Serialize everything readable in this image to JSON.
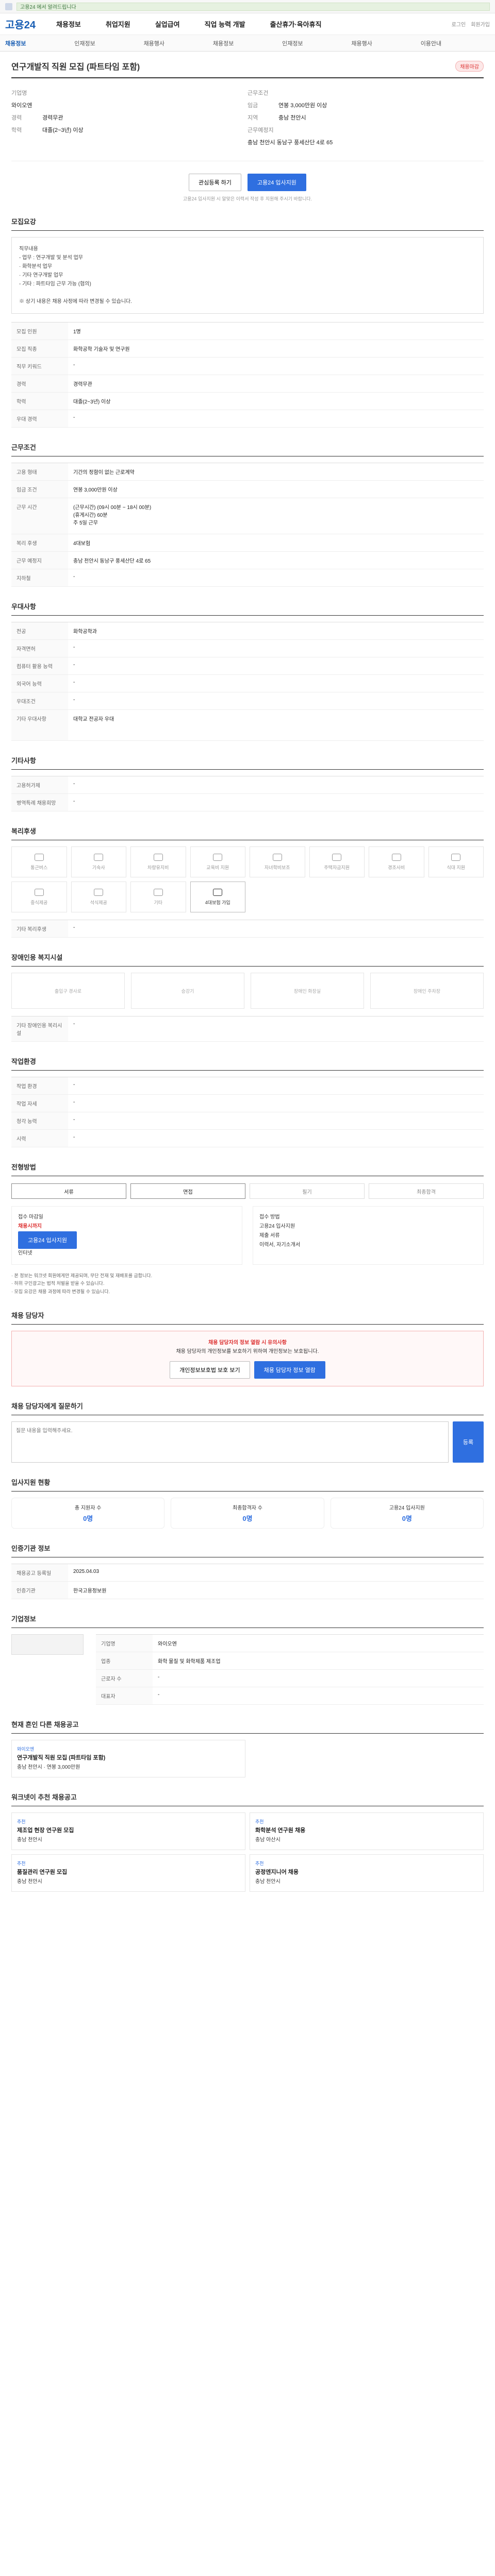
{
  "topbar": {
    "notice": "고용24 에서 알려드립니다"
  },
  "header": {
    "logo": "고용24",
    "nav": [
      "채용정보",
      "취업지원",
      "실업급여",
      "직업 능력 개발",
      "출산휴가·육아휴직"
    ],
    "util": [
      "로그인",
      "회원가입"
    ]
  },
  "tabs": [
    "채용정보",
    "인재정보",
    "채용행사",
    "채용정보",
    "인재정보",
    "채용행사",
    "이용안내"
  ],
  "job": {
    "title": "연구개발직 직원 모집 (파트타임 포함)",
    "badge": "채용마감",
    "company_label": "기업명",
    "company": "와이오엔",
    "left_kv": [
      {
        "k": "경력",
        "v": "경력무관"
      },
      {
        "k": "학력",
        "v": "대졸(2~3년) 이상"
      }
    ],
    "cond_label": "근무조건",
    "cond_kv": [
      {
        "k": "임금",
        "v": "연봉 3,000만원 이상"
      },
      {
        "k": "지역",
        "v": "충남 천안시"
      }
    ],
    "place_label": "근무예정지",
    "place": "충남 천안시 동남구 풍세산단 4로 65",
    "apply_buttons": [
      "관심등록 하기",
      "고용24 입사지원"
    ],
    "apply_note": "고용24 입사지원 시 알맞은 이력서 작성 후 지원해 주시기 바랍니다."
  },
  "sections": {
    "desc_title": "모집요강",
    "desc_body": "직무내용\n- 업무 : 연구개발 및 분석 업무\n  · 화학분석 업무\n  · 기타 연구개발 업무\n- 기타 : 파트타임 근무 가능 (협의)\n\n※ 상기 내용은 채용 사정에 따라 변경될 수 있습니다.",
    "info_rows": [
      {
        "k": "모집 인원",
        "v": "1명"
      },
      {
        "k": "모집 직종",
        "v": "화학공학 기술자 및 연구원"
      },
      {
        "k": "직무 키워드",
        "v": "-"
      },
      {
        "k": "경력",
        "v": "경력무관"
      },
      {
        "k": "학력",
        "v": "대졸(2~3년) 이상"
      },
      {
        "k": "우대 경력",
        "v": "-"
      }
    ],
    "cond_title": "근무조건",
    "cond_rows": [
      {
        "k": "고용 형태",
        "v": "기간의 정함이 없는 근로계약"
      },
      {
        "k": "임금 조건",
        "v": "연봉 3,000만원 이상"
      },
      {
        "k": "근무 시간",
        "v": "(근무시간) (09시 00분 ~ 18시 00분)\n(휴게시간) 60분\n주 5일 근무"
      },
      {
        "k": "복리 후생",
        "v": "4대보험"
      },
      {
        "k": "근무 예정지",
        "v": "충남 천안시 동남구 풍세산단 4로 65"
      },
      {
        "k": "지하철",
        "v": "-"
      }
    ],
    "pref_title": "우대사항",
    "pref_rows": [
      {
        "k": "전공",
        "v": "화학공학과"
      },
      {
        "k": "자격면허",
        "v": "-"
      },
      {
        "k": "컴퓨터 활용 능력",
        "v": "-"
      },
      {
        "k": "외국어 능력",
        "v": "-"
      },
      {
        "k": "우대조건",
        "v": "-"
      },
      {
        "k": "기타 우대사항",
        "v": "대학교 전공자 우대"
      }
    ],
    "etc_title": "기타사항",
    "etc_rows": [
      {
        "k": "고용허가제",
        "v": "-"
      },
      {
        "k": "병역특례 채용희망",
        "v": "-"
      }
    ],
    "welfare_title": "복리후생",
    "welfare_items": [
      "통근버스",
      "기숙사",
      "차량유지비",
      "교육비 지원",
      "자녀학비보조",
      "주택자금지원",
      "경조사비",
      "식대 지원",
      "중식제공",
      "석식제공",
      "기타",
      "4대보험 가입"
    ],
    "welfare_on": 11,
    "welfare_other_title": "기타 복리후생",
    "welfare_other": "-",
    "disab_title": "장애인용 복지시설",
    "disab_items": [
      "출입구 경사로",
      "승강기",
      "장애인 화장실",
      "장애인 주차장"
    ],
    "disab_other_title": "기타 장애인용 복리시설",
    "disab_other": "-",
    "work_title": "작업환경",
    "work_rows": [
      {
        "k": "작업 환경",
        "v": "-"
      },
      {
        "k": "작업 자세",
        "v": "-"
      },
      {
        "k": "청각 능력",
        "v": "-"
      },
      {
        "k": "시력",
        "v": "-"
      }
    ],
    "proc_title": "전형방법",
    "proc_steps": [
      "서류",
      "면접",
      "필기",
      "최종합격"
    ],
    "method_left": [
      "접수 마감일",
      "채용시까지",
      "고용24 입사지원",
      "인터넷"
    ],
    "method_right": [
      "접수 방법",
      "고용24 입사지원",
      "제출 서류",
      "이력서, 자기소개서"
    ],
    "notes": "· 본 정보는 워크넷 회원에게만 제공되며, 무단 전재 및 재배포를 금합니다.\n· 허위 구인광고는 법적 처벌을 받을 수 있습니다.\n· 모집 요강은 채용 과정에 따라 변경될 수 있습니다.",
    "contact_title": "채용 담당자",
    "warn_line1": "채용 담당자의 정보 열람 시 유의사항",
    "warn_line2": "채용 담당자의 개인정보를 보호하기 위하여 개인정보는 보호됩니다.",
    "warn_buttons": [
      "개인정보보호법 보호 보기",
      "채용 담당자 정보 열람"
    ],
    "qa_title": "채용 담당자에게 질문하기",
    "qa_placeholder": "질문 내용을 입력해주세요.",
    "qa_button": "등록",
    "apply_stat_title": "입사지원 현황",
    "apply_stats": [
      {
        "label": "총 지원자 수",
        "value": "0명"
      },
      {
        "label": "최종합격자 수",
        "value": "0명"
      },
      {
        "label": "고용24 입사지원",
        "value": "0명"
      }
    ],
    "agency_title": "인증기관 정보",
    "agency_rows": [
      {
        "k": "채용공고 등록일",
        "v": "2025.04.03"
      },
      {
        "k": "인증기관",
        "v": "한국고용정보원"
      }
    ],
    "corp_title": "기업정보",
    "corp_rows": [
      {
        "k": "기업명",
        "v": "와이오엔"
      },
      {
        "k": "업종",
        "v": "화학 물질 및 화학제품 제조업"
      },
      {
        "k": "근로자 수",
        "v": "-"
      },
      {
        "k": "대표자",
        "v": "-"
      }
    ],
    "similar_title": "현재 흔인 다른 채용공고",
    "similar": [
      {
        "tag": "와이오엔",
        "ttl": "연구개발직 직원 모집 (파트타임 포함)",
        "meta": "충남 천안시 · 연봉 3,000만원"
      }
    ],
    "recommend_title": "워크넷이 추천 채용공고",
    "recommend": [
      {
        "tag": "추천",
        "ttl": "제조업 현장 연구원 모집",
        "meta": "충남 천안시"
      },
      {
        "tag": "추천",
        "ttl": "화학분석 연구원 채용",
        "meta": "충남 아산시"
      },
      {
        "tag": "추천",
        "ttl": "품질관리 연구원 모집",
        "meta": "충남 천안시"
      },
      {
        "tag": "추천",
        "ttl": "공정엔지니어 채용",
        "meta": "충남 천안시"
      }
    ]
  }
}
